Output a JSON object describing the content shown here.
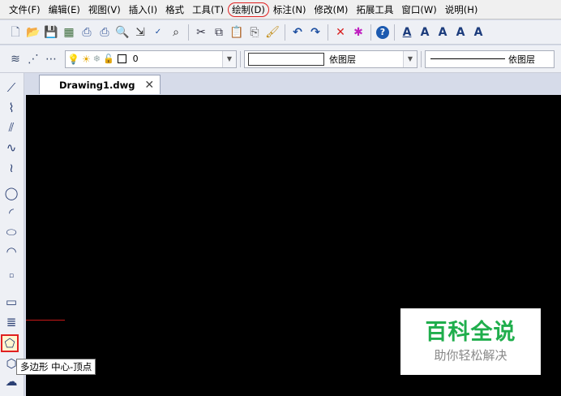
{
  "menu": [
    "文件(F)",
    "编辑(E)",
    "视图(V)",
    "插入(I)",
    "格式",
    "工具(T)",
    "绘制(D)",
    "标注(N)",
    "修改(M)",
    "拓展工具",
    "窗口(W)",
    "说明(H)"
  ],
  "layer": {
    "name": "0"
  },
  "color_combo": {
    "label": "依图层"
  },
  "linetype_combo": {
    "label": "依图层"
  },
  "tab": {
    "label": "Drawing1.dwg",
    "close": "✕"
  },
  "tooltip": {
    "text": "多边形 中心-顶点"
  },
  "watermark": {
    "title": "百科全说",
    "subtitle": "助你轻松解决"
  },
  "colors": {
    "highlight": "#e02020",
    "canvas": "#000000",
    "watermark_green": "#1fae4c"
  }
}
